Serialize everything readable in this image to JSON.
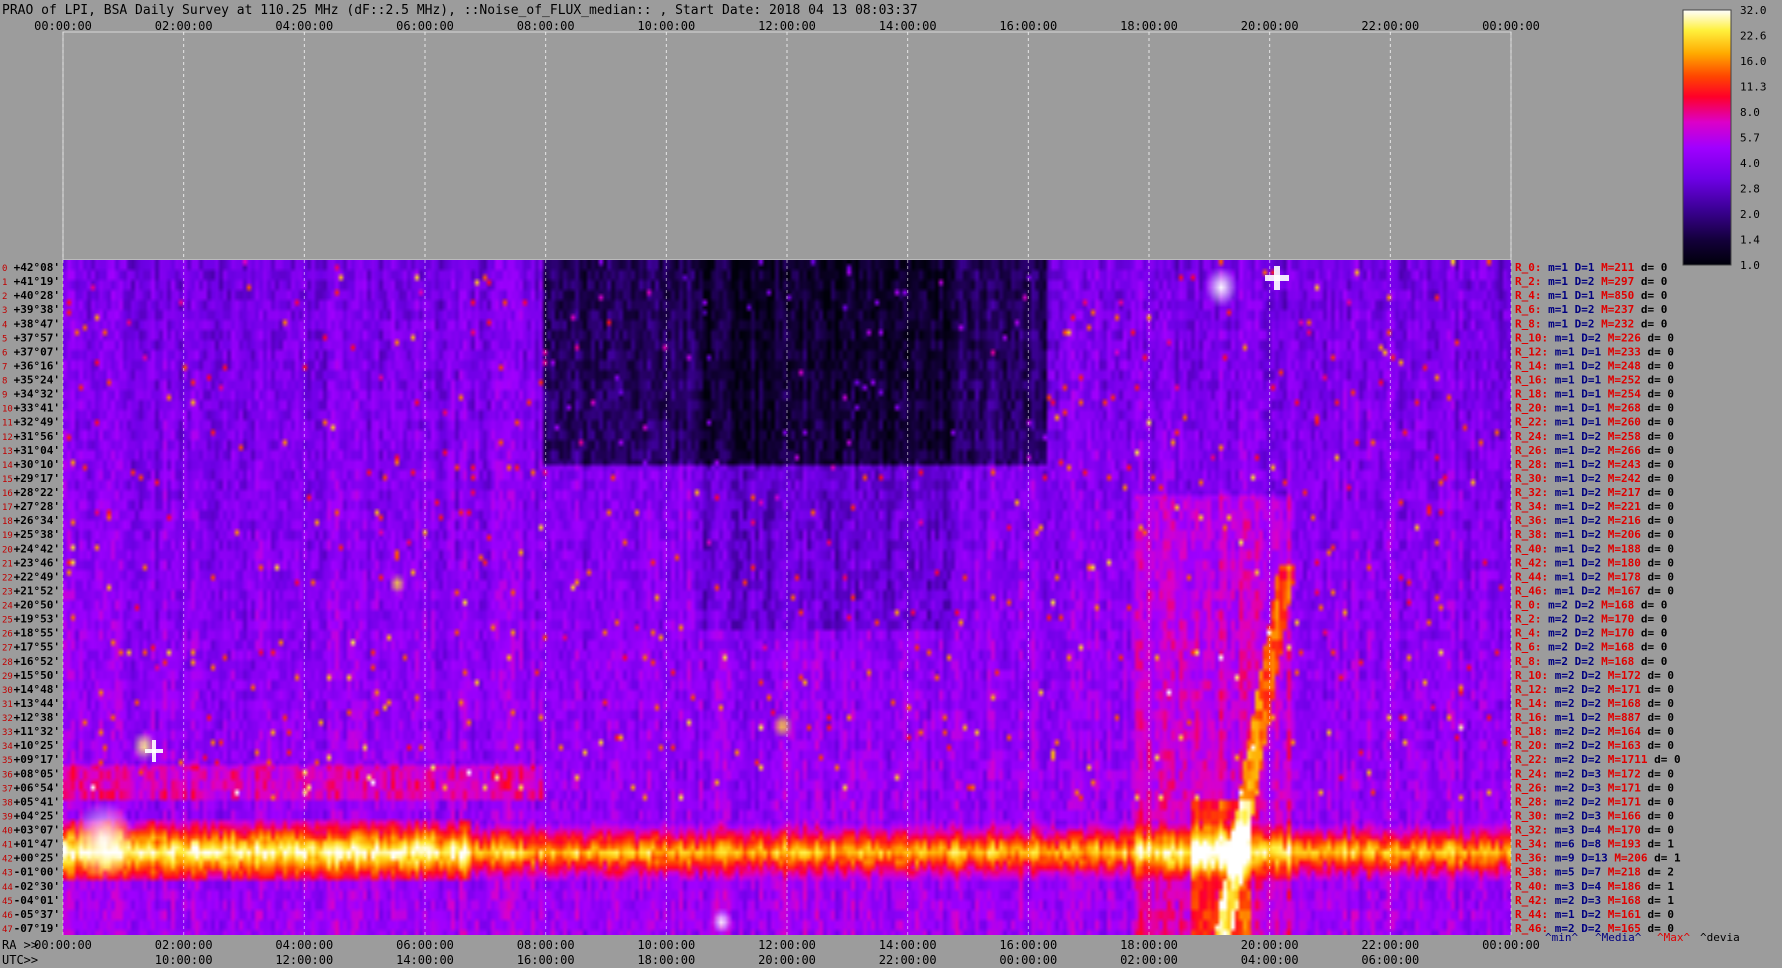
{
  "title": "PRAO of LPI, BSA Daily Survey at 110.25 MHz (dF::2.5 MHz), ::Noise_of_FLUX_median:: , Start Date: 2018 04 13 08:03:37",
  "colors": {
    "background": "#9c9c9c",
    "low": "#000010",
    "mid": "#8a00ff",
    "high": "#ff0000",
    "top": "#ffffff"
  },
  "chart_data": {
    "type": "heatmap",
    "title": "PRAO of LPI, BSA Daily Survey at 110.25 MHz (dF::2.5 MHz), ::Noise_of_FLUX_median:: , Start Date: 2018 04 13 08:03:37",
    "x_top_ticks": [
      "00:00:00",
      "02:00:00",
      "04:00:00",
      "06:00:00",
      "08:00:00",
      "10:00:00",
      "12:00:00",
      "14:00:00",
      "16:00:00",
      "18:00:00",
      "20:00:00",
      "22:00:00",
      "00:00:00"
    ],
    "x_bottom_ra_prefix": "RA >>",
    "x_bottom_ra_ticks": [
      "00:00:00",
      "02:00:00",
      "04:00:00",
      "06:00:00",
      "08:00:00",
      "10:00:00",
      "12:00:00",
      "14:00:00",
      "16:00:00",
      "18:00:00",
      "20:00:00",
      "22:00:00",
      "00:00:00"
    ],
    "x_bottom_utc_prefix": "UTC>>",
    "x_bottom_utc_ticks": [
      "10:00:00",
      "12:00:00",
      "14:00:00",
      "16:00:00",
      "18:00:00",
      "20:00:00",
      "22:00:00",
      "00:00:00",
      "02:00:00",
      "04:00:00",
      "06:00:00"
    ],
    "declinations": [
      "+42°08'",
      "+41°19'",
      "+40°28'",
      "+39°38'",
      "+38°47'",
      "+37°57'",
      "+37°07'",
      "+36°16'",
      "+35°24'",
      "+34°32'",
      "+33°41'",
      "+32°49'",
      "+31°56'",
      "+31°04'",
      "+30°10'",
      "+29°17'",
      "+28°22'",
      "+27°28'",
      "+26°34'",
      "+25°38'",
      "+24°42'",
      "+23°46'",
      "+22°49'",
      "+21°52'",
      "+20°50'",
      "+19°53'",
      "+18°55'",
      "+17°55'",
      "+16°52'",
      "+15°50'",
      "+14°48'",
      "+13°44'",
      "+12°38'",
      "+11°32'",
      "+10°25'",
      "+09°17'",
      "+08°05'",
      "+06°54'",
      "+05°41'",
      "+04°25'",
      "+03°07'",
      "+01°47'",
      "+00°25'",
      "-01°00'",
      "-02°30'",
      "-04°01'",
      "-05°37'",
      "-07°19'"
    ],
    "row_labels": [
      {
        "r": "R_0:",
        "m": "m=1",
        "d": "D=1",
        "M": "M=211",
        "dev": "d= 0"
      },
      {
        "r": "R_2:",
        "m": "m=1",
        "d": "D=2",
        "M": "M=297",
        "dev": "d= 0"
      },
      {
        "r": "R_4:",
        "m": "m=1",
        "d": "D=1",
        "M": "M=850",
        "dev": "d= 0"
      },
      {
        "r": "R_6:",
        "m": "m=1",
        "d": "D=2",
        "M": "M=237",
        "dev": "d= 0"
      },
      {
        "r": "R_8:",
        "m": "m=1",
        "d": "D=2",
        "M": "M=232",
        "dev": "d= 0"
      },
      {
        "r": "R_10:",
        "m": "m=1",
        "d": "D=2",
        "M": "M=226",
        "dev": "d= 0"
      },
      {
        "r": "R_12:",
        "m": "m=1",
        "d": "D=1",
        "M": "M=233",
        "dev": "d= 0"
      },
      {
        "r": "R_14:",
        "m": "m=1",
        "d": "D=2",
        "M": "M=248",
        "dev": "d= 0"
      },
      {
        "r": "R_16:",
        "m": "m=1",
        "d": "D=1",
        "M": "M=252",
        "dev": "d= 0"
      },
      {
        "r": "R_18:",
        "m": "m=1",
        "d": "D=1",
        "M": "M=254",
        "dev": "d= 0"
      },
      {
        "r": "R_20:",
        "m": "m=1",
        "d": "D=1",
        "M": "M=268",
        "dev": "d= 0"
      },
      {
        "r": "R_22:",
        "m": "m=1",
        "d": "D=1",
        "M": "M=260",
        "dev": "d= 0"
      },
      {
        "r": "R_24:",
        "m": "m=1",
        "d": "D=2",
        "M": "M=258",
        "dev": "d= 0"
      },
      {
        "r": "R_26:",
        "m": "m=1",
        "d": "D=2",
        "M": "M=266",
        "dev": "d= 0"
      },
      {
        "r": "R_28:",
        "m": "m=1",
        "d": "D=2",
        "M": "M=243",
        "dev": "d= 0"
      },
      {
        "r": "R_30:",
        "m": "m=1",
        "d": "D=2",
        "M": "M=242",
        "dev": "d= 0"
      },
      {
        "r": "R_32:",
        "m": "m=1",
        "d": "D=2",
        "M": "M=217",
        "dev": "d= 0"
      },
      {
        "r": "R_34:",
        "m": "m=1",
        "d": "D=2",
        "M": "M=221",
        "dev": "d= 0"
      },
      {
        "r": "R_36:",
        "m": "m=1",
        "d": "D=2",
        "M": "M=216",
        "dev": "d= 0"
      },
      {
        "r": "R_38:",
        "m": "m=1",
        "d": "D=2",
        "M": "M=206",
        "dev": "d= 0"
      },
      {
        "r": "R_40:",
        "m": "m=1",
        "d": "D=2",
        "M": "M=188",
        "dev": "d= 0"
      },
      {
        "r": "R_42:",
        "m": "m=1",
        "d": "D=2",
        "M": "M=180",
        "dev": "d= 0"
      },
      {
        "r": "R_44:",
        "m": "m=1",
        "d": "D=2",
        "M": "M=178",
        "dev": "d= 0"
      },
      {
        "r": "R_46:",
        "m": "m=1",
        "d": "D=2",
        "M": "M=167",
        "dev": "d= 0"
      },
      {
        "r": "R_0:",
        "m": "m=2",
        "d": "D=2",
        "M": "M=168",
        "dev": "d= 0"
      },
      {
        "r": "R_2:",
        "m": "m=2",
        "d": "D=2",
        "M": "M=170",
        "dev": "d= 0"
      },
      {
        "r": "R_4:",
        "m": "m=2",
        "d": "D=2",
        "M": "M=170",
        "dev": "d= 0"
      },
      {
        "r": "R_6:",
        "m": "m=2",
        "d": "D=2",
        "M": "M=168",
        "dev": "d= 0"
      },
      {
        "r": "R_8:",
        "m": "m=2",
        "d": "D=2",
        "M": "M=168",
        "dev": "d= 0"
      },
      {
        "r": "R_10:",
        "m": "m=2",
        "d": "D=2",
        "M": "M=172",
        "dev": "d= 0"
      },
      {
        "r": "R_12:",
        "m": "m=2",
        "d": "D=2",
        "M": "M=171",
        "dev": "d= 0"
      },
      {
        "r": "R_14:",
        "m": "m=2",
        "d": "D=2",
        "M": "M=168",
        "dev": "d= 0"
      },
      {
        "r": "R_16:",
        "m": "m=1",
        "d": "D=2",
        "M": "M=887",
        "dev": "d= 0"
      },
      {
        "r": "R_18:",
        "m": "m=2",
        "d": "D=2",
        "M": "M=164",
        "dev": "d= 0"
      },
      {
        "r": "R_20:",
        "m": "m=2",
        "d": "D=2",
        "M": "M=163",
        "dev": "d= 0"
      },
      {
        "r": "R_22:",
        "m": "m=2",
        "d": "D=2",
        "M": "M=1711",
        "dev": "d= 0"
      },
      {
        "r": "R_24:",
        "m": "m=2",
        "d": "D=3",
        "M": "M=172",
        "dev": "d= 0"
      },
      {
        "r": "R_26:",
        "m": "m=2",
        "d": "D=3",
        "M": "M=171",
        "dev": "d= 0"
      },
      {
        "r": "R_28:",
        "m": "m=2",
        "d": "D=2",
        "M": "M=171",
        "dev": "d= 0"
      },
      {
        "r": "R_30:",
        "m": "m=2",
        "d": "D=3",
        "M": "M=166",
        "dev": "d= 0"
      },
      {
        "r": "R_32:",
        "m": "m=3",
        "d": "D=4",
        "M": "M=170",
        "dev": "d= 0"
      },
      {
        "r": "R_34:",
        "m": "m=6",
        "d": "D=8",
        "M": "M=193",
        "dev": "d= 1"
      },
      {
        "r": "R_36:",
        "m": "m=9",
        "d": "D=13",
        "M": "M=206",
        "dev": "d= 1"
      },
      {
        "r": "R_38:",
        "m": "m=5",
        "d": "D=7",
        "M": "M=218",
        "dev": "d= 2"
      },
      {
        "r": "R_40:",
        "m": "m=3",
        "d": "D=4",
        "M": "M=186",
        "dev": "d= 1"
      },
      {
        "r": "R_42:",
        "m": "m=2",
        "d": "D=3",
        "M": "M=168",
        "dev": "d= 1"
      },
      {
        "r": "R_44:",
        "m": "m=1",
        "d": "D=2",
        "M": "M=161",
        "dev": "d= 0"
      },
      {
        "r": "R_46:",
        "m": "m=2",
        "d": "D=2",
        "M": "M=165",
        "dev": "d= 0"
      }
    ],
    "legend_labels": {
      "min": "^min^",
      "median": "^Media^",
      "max": "^Max^",
      "dev": "^devia"
    },
    "colorbar_ticks": [
      "32.0",
      "22.6",
      "16.0",
      "11.3",
      "8.0",
      "5.7",
      "4.0",
      "2.8",
      "2.0",
      "1.4",
      "1.0"
    ],
    "colorbar_scale": "log",
    "colorbar_range": [
      1.0,
      32.0
    ],
    "features": {
      "galactic_band_declinations": [
        "+01°47'",
        "+00°25'",
        "-01°00'",
        "-02°30'"
      ],
      "strong_sources_ra": [
        "01:20:00",
        "06:00:00",
        "11:55:00",
        "19:55:00",
        "20:00:00"
      ]
    }
  }
}
